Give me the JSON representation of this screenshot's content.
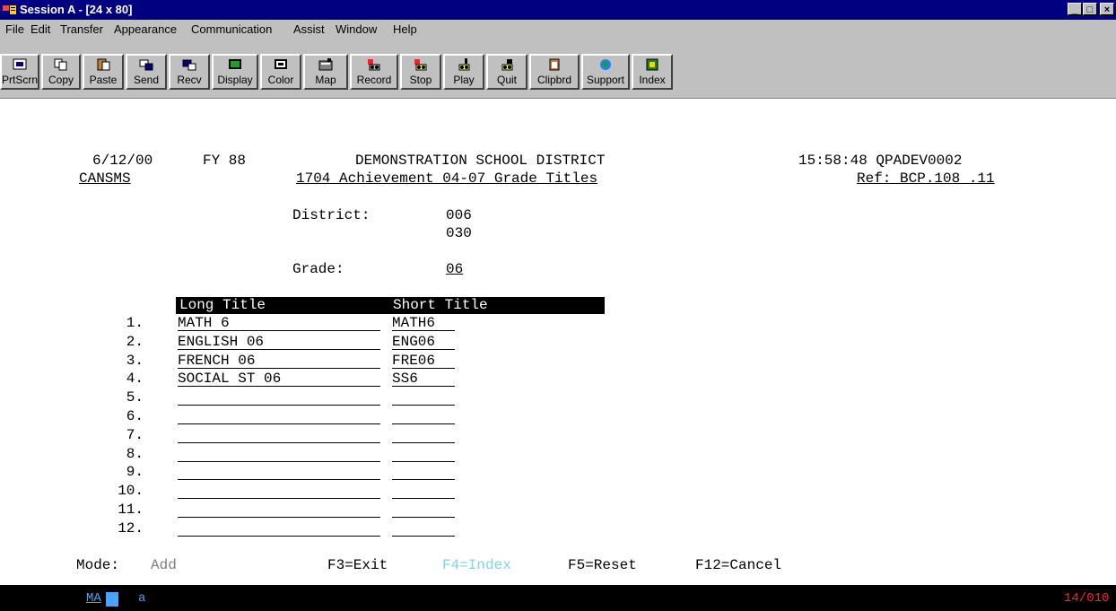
{
  "window": {
    "title": "Session A - [24 x 80]",
    "controls": [
      "_",
      "□",
      "×"
    ]
  },
  "menu": [
    "File",
    "Edit",
    "Transfer",
    "Appearance",
    "Communication",
    "Assist",
    "Window",
    "Help"
  ],
  "toolbar": [
    {
      "label": "PrtScrn",
      "icon": "printscreen-icon"
    },
    {
      "label": "Copy",
      "icon": "copy-icon"
    },
    {
      "label": "Paste",
      "icon": "paste-icon"
    },
    {
      "label": "Send",
      "icon": "send-icon"
    },
    {
      "label": "Recv",
      "icon": "receive-icon"
    },
    {
      "label": "Display",
      "icon": "display-icon"
    },
    {
      "label": "Color",
      "icon": "color-icon"
    },
    {
      "label": "Map",
      "icon": "map-icon"
    },
    {
      "label": "Record",
      "icon": "record-icon"
    },
    {
      "label": "Stop",
      "icon": "stop-icon"
    },
    {
      "label": "Play",
      "icon": "play-icon"
    },
    {
      "label": "Quit",
      "icon": "quit-icon"
    },
    {
      "label": "Clipbrd",
      "icon": "clipboard-icon"
    },
    {
      "label": "Support",
      "icon": "support-icon"
    },
    {
      "label": "Index",
      "icon": "index-icon"
    }
  ],
  "screen": {
    "date": "6/12/00",
    "fy": "FY 88",
    "district_name": "DEMONSTRATION SCHOOL DISTRICT",
    "time_code": "15:58:48 QPADEV0002",
    "program": "CANSMS",
    "subtitle": "1704 Achievement 04-07 Grade Titles",
    "ref": "Ref: BCP.108 .11",
    "district_label": "District:",
    "district_values": [
      "006",
      "030"
    ],
    "grade_label": "Grade:",
    "grade_value": "06",
    "col_long": "Long Title",
    "col_short": "Short Title",
    "rows": [
      {
        "num": "1.",
        "long": "MATH 6",
        "short": "MATH6"
      },
      {
        "num": "2.",
        "long": "ENGLISH 06",
        "short": "ENG06"
      },
      {
        "num": "3.",
        "long": "FRENCH 06",
        "short": "FRE06"
      },
      {
        "num": "4.",
        "long": "SOCIAL ST 06",
        "short": "SS6"
      },
      {
        "num": "5.",
        "long": "",
        "short": ""
      },
      {
        "num": "6.",
        "long": "",
        "short": ""
      },
      {
        "num": "7.",
        "long": "",
        "short": ""
      },
      {
        "num": "8.",
        "long": "",
        "short": ""
      },
      {
        "num": "9.",
        "long": "",
        "short": ""
      },
      {
        "num": "10.",
        "long": "",
        "short": ""
      },
      {
        "num": "11.",
        "long": "",
        "short": ""
      },
      {
        "num": "12.",
        "long": "",
        "short": ""
      }
    ],
    "mode_label": "Mode:",
    "mode_value": "Add",
    "fkeys": [
      "F3=Exit",
      "F4=Index",
      "F5=Reset",
      "F12=Cancel"
    ]
  },
  "status": {
    "left": "MA",
    "indicator": "a",
    "cursor_pos": "14/010"
  },
  "colors": {
    "titlebar": "#000080",
    "chrome": "#c0c0c0",
    "f4_highlight": "#7fd3e8",
    "mode_value": "#808080",
    "status_left": "#4aa3ff",
    "status_pos": "#ff2020"
  }
}
